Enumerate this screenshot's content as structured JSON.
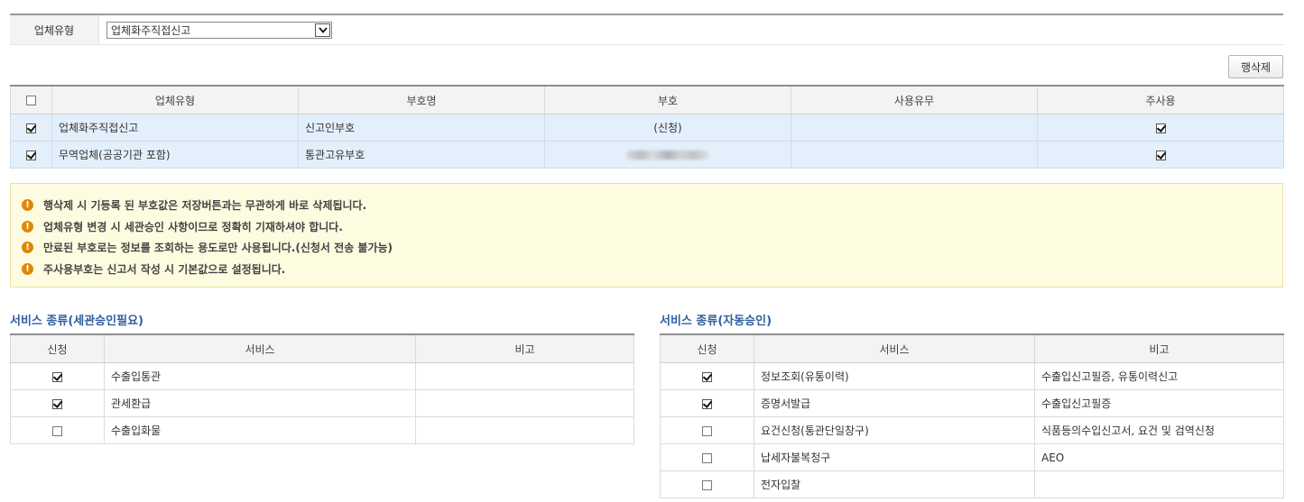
{
  "filter": {
    "label": "업체유형",
    "selected": "업체화주직접신고"
  },
  "toolbar": {
    "delete_row_label": "행삭제"
  },
  "main_table": {
    "headers": [
      "업체유형",
      "부호명",
      "부호",
      "사용유무",
      "주사용"
    ],
    "rows": [
      {
        "checked": true,
        "type": "업체화주직접신고",
        "code_name": "신고인부호",
        "code": "(신청)",
        "usage": "",
        "primary": true
      },
      {
        "checked": true,
        "type": "무역업체(공공기관 포함)",
        "code_name": "통관고유부호",
        "code": "",
        "usage": "",
        "primary": true
      }
    ]
  },
  "notices": [
    "행삭제 시 기등록 된 부호값은 저장버튼과는 무관하게 바로 삭제됩니다.",
    "업체유형 변경 시 세관승인 사항이므로 정확히 기재하셔야 합니다.",
    "만료된 부호로는 정보를 조회하는 용도로만 사용됩니다.(신청서 전송 불가능)",
    "주사용부호는 신고서 작성 시 기본값으로 설정됩니다."
  ],
  "services_approval": {
    "title": "서비스 종류(세관승인필요)",
    "headers": [
      "신청",
      "서비스",
      "비고"
    ],
    "rows": [
      {
        "checked": true,
        "service": "수출입통관",
        "note": ""
      },
      {
        "checked": true,
        "service": "관세환급",
        "note": ""
      },
      {
        "checked": false,
        "service": "수출입화물",
        "note": ""
      }
    ]
  },
  "services_auto": {
    "title": "서비스 종류(자동승인)",
    "headers": [
      "신청",
      "서비스",
      "비고"
    ],
    "rows": [
      {
        "checked": true,
        "service": "정보조회(유통이력)",
        "note": "수출입신고필증, 유통이력신고"
      },
      {
        "checked": true,
        "service": "증명서발급",
        "note": "수출입신고필증"
      },
      {
        "checked": false,
        "service": "요건신청(통관단일창구)",
        "note": "식품등의수입신고서, 요건 및 검역신청"
      },
      {
        "checked": false,
        "service": "납세자불복청구",
        "note": "AEO"
      },
      {
        "checked": false,
        "service": "전자입찰",
        "note": ""
      }
    ]
  }
}
